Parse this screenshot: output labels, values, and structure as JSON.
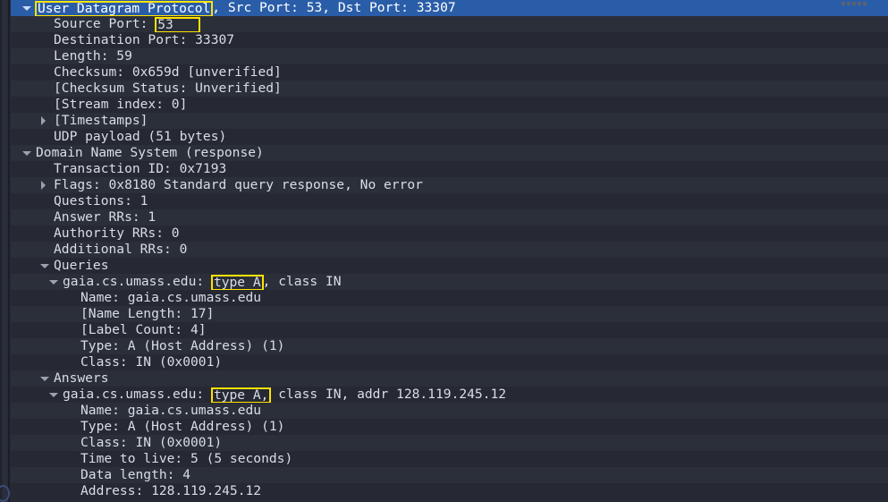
{
  "window": {
    "title": "Wireshark packet details",
    "grip_icon": "drag-grip-icon"
  },
  "theme": {
    "background": "#272b35",
    "row_alt_a": "#262933",
    "row_alt_b": "#2b2f3a",
    "selection_blue": "#2a5da8",
    "text": "#d8dde8",
    "selected_text": "#ffffff",
    "highlight_border": "#ffe200",
    "twisty": "#9aa1b0"
  },
  "tree": {
    "rows": [
      {
        "id": "udp-protocol",
        "indent": 0,
        "twisty": "open",
        "selected": true,
        "segments": [
          {
            "text": "User Datagram Protocol",
            "highlight": "box"
          },
          {
            "text": ", Src Port: 53, Dst Port: 33307"
          }
        ],
        "plain": "User Datagram Protocol, Src Port: 53, Dst Port: 33307"
      },
      {
        "id": "udp-source-port",
        "indent": 2,
        "twisty": "none",
        "segments": [
          {
            "text": "Source Port: "
          },
          {
            "text": "53",
            "highlight": "box-wide"
          }
        ],
        "plain": "Source Port: 53"
      },
      {
        "id": "udp-destination-port",
        "indent": 2,
        "twisty": "none",
        "segments": [
          {
            "text": "Destination Port: 33307"
          }
        ],
        "plain": "Destination Port: 33307"
      },
      {
        "id": "udp-length",
        "indent": 2,
        "twisty": "none",
        "segments": [
          {
            "text": "Length: 59"
          }
        ],
        "plain": "Length: 59"
      },
      {
        "id": "udp-checksum",
        "indent": 2,
        "twisty": "none",
        "segments": [
          {
            "text": "Checksum: 0x659d [unverified]"
          }
        ],
        "plain": "Checksum: 0x659d [unverified]"
      },
      {
        "id": "udp-checksum-status",
        "indent": 2,
        "twisty": "none",
        "segments": [
          {
            "text": "[Checksum Status: Unverified]"
          }
        ],
        "plain": "[Checksum Status: Unverified]"
      },
      {
        "id": "udp-stream-index",
        "indent": 2,
        "twisty": "none",
        "segments": [
          {
            "text": "[Stream index: 0]"
          }
        ],
        "plain": "[Stream index: 0]"
      },
      {
        "id": "udp-timestamps",
        "indent": 2,
        "twisty": "closed",
        "segments": [
          {
            "text": "[Timestamps]"
          }
        ],
        "plain": "[Timestamps]"
      },
      {
        "id": "udp-payload",
        "indent": 2,
        "twisty": "none",
        "segments": [
          {
            "text": "UDP payload (51 bytes)"
          }
        ],
        "plain": "UDP payload (51 bytes)"
      },
      {
        "id": "dns-root",
        "indent": 0,
        "twisty": "open",
        "segments": [
          {
            "text": "Domain Name System (response)"
          }
        ],
        "plain": "Domain Name System (response)"
      },
      {
        "id": "dns-transaction-id",
        "indent": 2,
        "twisty": "none",
        "segments": [
          {
            "text": "Transaction ID: 0x7193"
          }
        ],
        "plain": "Transaction ID: 0x7193"
      },
      {
        "id": "dns-flags",
        "indent": 2,
        "twisty": "closed",
        "segments": [
          {
            "text": "Flags: 0x8180 Standard query response, No error"
          }
        ],
        "plain": "Flags: 0x8180 Standard query response, No error"
      },
      {
        "id": "dns-questions",
        "indent": 2,
        "twisty": "none",
        "segments": [
          {
            "text": "Questions: 1"
          }
        ],
        "plain": "Questions: 1"
      },
      {
        "id": "dns-answer-rrs",
        "indent": 2,
        "twisty": "none",
        "segments": [
          {
            "text": "Answer RRs: 1"
          }
        ],
        "plain": "Answer RRs: 1"
      },
      {
        "id": "dns-authority-rrs",
        "indent": 2,
        "twisty": "none",
        "segments": [
          {
            "text": "Authority RRs: 0"
          }
        ],
        "plain": "Authority RRs: 0"
      },
      {
        "id": "dns-additional-rrs",
        "indent": 2,
        "twisty": "none",
        "segments": [
          {
            "text": "Additional RRs: 0"
          }
        ],
        "plain": "Additional RRs: 0"
      },
      {
        "id": "dns-queries",
        "indent": 2,
        "twisty": "open",
        "segments": [
          {
            "text": "Queries"
          }
        ],
        "plain": "Queries"
      },
      {
        "id": "dns-query-record",
        "indent": 3,
        "twisty": "open",
        "segments": [
          {
            "text": "gaia.cs.umass.edu: "
          },
          {
            "text": "type A",
            "highlight": "box"
          },
          {
            "text": ", class IN"
          }
        ],
        "plain": "gaia.cs.umass.edu: type A, class IN"
      },
      {
        "id": "dns-query-name",
        "indent": 5,
        "twisty": "none",
        "segments": [
          {
            "text": "Name: gaia.cs.umass.edu"
          }
        ],
        "plain": "Name: gaia.cs.umass.edu"
      },
      {
        "id": "dns-query-name-length",
        "indent": 5,
        "twisty": "none",
        "segments": [
          {
            "text": "[Name Length: 17]"
          }
        ],
        "plain": "[Name Length: 17]"
      },
      {
        "id": "dns-query-label-count",
        "indent": 5,
        "twisty": "none",
        "segments": [
          {
            "text": "[Label Count: 4]"
          }
        ],
        "plain": "[Label Count: 4]"
      },
      {
        "id": "dns-query-type",
        "indent": 5,
        "twisty": "none",
        "segments": [
          {
            "text": "Type: A (Host Address) (1)"
          }
        ],
        "plain": "Type: A (Host Address) (1)"
      },
      {
        "id": "dns-query-class",
        "indent": 5,
        "twisty": "none",
        "segments": [
          {
            "text": "Class: IN (0x0001)"
          }
        ],
        "plain": "Class: IN (0x0001)"
      },
      {
        "id": "dns-answers",
        "indent": 2,
        "twisty": "open",
        "segments": [
          {
            "text": "Answers"
          }
        ],
        "plain": "Answers"
      },
      {
        "id": "dns-answer-record",
        "indent": 3,
        "twisty": "open",
        "segments": [
          {
            "text": "gaia.cs.umass.edu: "
          },
          {
            "text": "type A,",
            "highlight": "box"
          },
          {
            "text": " class IN, addr 128.119.245.12"
          }
        ],
        "plain": "gaia.cs.umass.edu: type A, class IN, addr 128.119.245.12"
      },
      {
        "id": "dns-answer-name",
        "indent": 5,
        "twisty": "none",
        "segments": [
          {
            "text": "Name: gaia.cs.umass.edu"
          }
        ],
        "plain": "Name: gaia.cs.umass.edu"
      },
      {
        "id": "dns-answer-type",
        "indent": 5,
        "twisty": "none",
        "segments": [
          {
            "text": "Type: A (Host Address) (1)"
          }
        ],
        "plain": "Type: A (Host Address) (1)"
      },
      {
        "id": "dns-answer-class",
        "indent": 5,
        "twisty": "none",
        "segments": [
          {
            "text": "Class: IN (0x0001)"
          }
        ],
        "plain": "Class: IN (0x0001)"
      },
      {
        "id": "dns-answer-ttl",
        "indent": 5,
        "twisty": "none",
        "segments": [
          {
            "text": "Time to live: 5 (5 seconds)"
          }
        ],
        "plain": "Time to live: 5 (5 seconds)"
      },
      {
        "id": "dns-answer-data-length",
        "indent": 5,
        "twisty": "none",
        "segments": [
          {
            "text": "Data length: 4"
          }
        ],
        "plain": "Data length: 4"
      },
      {
        "id": "dns-answer-address",
        "indent": 5,
        "twisty": "none",
        "segments": [
          {
            "text": "Address: 128.119.245.12"
          }
        ],
        "plain": "Address: 128.119.245.12"
      }
    ]
  }
}
